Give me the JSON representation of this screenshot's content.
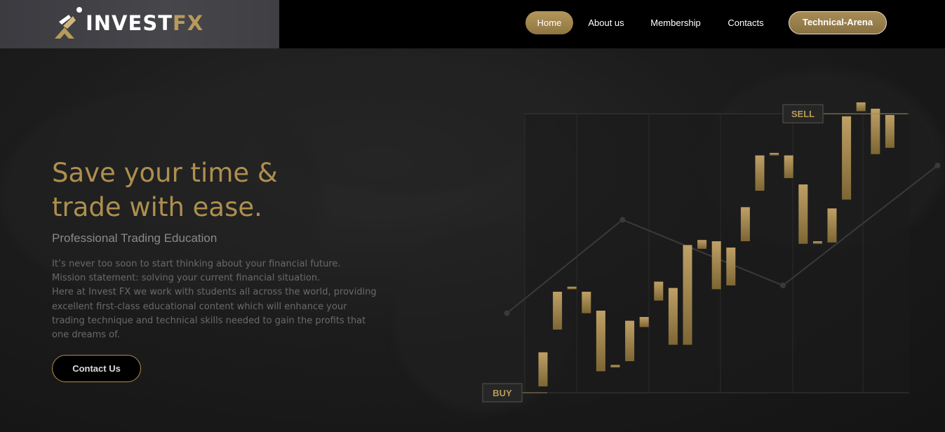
{
  "brand": {
    "name_main": "INVEST",
    "name_accent": "FX",
    "accent_color": "#b89a5a",
    "icon": "invest-fx-logo-icon"
  },
  "nav": {
    "items": [
      {
        "label": "Home",
        "active": true
      },
      {
        "label": "About us",
        "active": false
      },
      {
        "label": "Membership",
        "active": false
      },
      {
        "label": "Contacts",
        "active": false
      },
      {
        "label": "Technical-Arena",
        "active": false,
        "highlighted": true
      }
    ]
  },
  "hero": {
    "title_line1": "Save your time &",
    "title_line2": "trade with ease.",
    "subtitle": "Professional Trading Education",
    "description_lines": [
      "It’s never too soon to start thinking about your financial future.",
      "Mission statement: solving your current financial situation.",
      "Here at Invest FX we work with students all across the world, providing",
      "excellent first-class educational content which will enhance your",
      "trading technique and technical skills needed to gain the profits that",
      "one dreams of."
    ],
    "cta_label": "Contact Us"
  },
  "chart_labels": {
    "sell": "SELL",
    "buy": "BUY"
  },
  "chart_data": {
    "type": "candlestick",
    "candles": [
      {
        "open": 5,
        "close": 32
      },
      {
        "open": 50,
        "close": 80
      },
      {
        "open": 82,
        "close": 84
      },
      {
        "open": 63,
        "close": 80
      },
      {
        "open": 17,
        "close": 65
      },
      {
        "open": 20,
        "close": 22
      },
      {
        "open": 25,
        "close": 57
      },
      {
        "open": 52,
        "close": 60
      },
      {
        "open": 73,
        "close": 88
      },
      {
        "open": 38,
        "close": 83
      },
      {
        "open": 38,
        "close": 117
      },
      {
        "open": 114,
        "close": 121
      },
      {
        "open": 82,
        "close": 120
      },
      {
        "open": 85,
        "close": 115
      },
      {
        "open": 120,
        "close": 147
      },
      {
        "open": 160,
        "close": 188
      },
      {
        "open": 188,
        "close": 190
      },
      {
        "open": 170,
        "close": 188
      },
      {
        "open": 118,
        "close": 165
      },
      {
        "open": 118,
        "close": 120
      },
      {
        "open": 119,
        "close": 146
      },
      {
        "open": 153,
        "close": 219
      },
      {
        "open": 223,
        "close": 230
      },
      {
        "open": 189,
        "close": 225
      },
      {
        "open": 194,
        "close": 220
      }
    ],
    "trend_line": [
      {
        "i": -2.5,
        "v": 63
      },
      {
        "i": 5.5,
        "v": 137
      },
      {
        "i": 16.6,
        "v": 85
      },
      {
        "i": 27.3,
        "v": 180
      }
    ],
    "buy_level": 0,
    "sell_level": 221,
    "ylim": [
      -10,
      235
    ]
  }
}
